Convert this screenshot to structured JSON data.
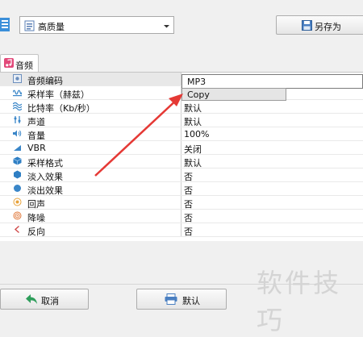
{
  "toolbar": {
    "quality_value": "高质量",
    "save_as_label": "另存为"
  },
  "tabs": [
    {
      "label": "音频"
    }
  ],
  "properties": [
    {
      "label": "音频编码",
      "value": "MP3",
      "icon": "audio-codec-icon"
    },
    {
      "label": "采样率（赫兹）",
      "value": "Copy",
      "icon": "sample-rate-icon"
    },
    {
      "label": "比特率（Kb/秒）",
      "value": "默认",
      "icon": "bitrate-icon"
    },
    {
      "label": "声道",
      "value": "默认",
      "icon": "channel-icon"
    },
    {
      "label": "音量",
      "value": "100%",
      "icon": "volume-icon"
    },
    {
      "label": "VBR",
      "value": "关闭",
      "icon": "vbr-icon"
    },
    {
      "label": "采样格式",
      "value": "默认",
      "icon": "sample-format-icon"
    },
    {
      "label": "淡入效果",
      "value": "否",
      "icon": "fade-in-icon"
    },
    {
      "label": "淡出效果",
      "value": "否",
      "icon": "fade-out-icon"
    },
    {
      "label": "回声",
      "value": "否",
      "icon": "echo-icon"
    },
    {
      "label": "降噪",
      "value": "否",
      "icon": "noise-reduction-icon"
    },
    {
      "label": "反向",
      "value": "否",
      "icon": "reverse-icon"
    }
  ],
  "format_dropdown": {
    "selected": "MP3",
    "options": [
      "Copy"
    ]
  },
  "bottom_buttons": {
    "cancel_label": "取消",
    "default_label": "默认"
  },
  "watermark": "软件技巧",
  "annotation_color": "#e53935"
}
